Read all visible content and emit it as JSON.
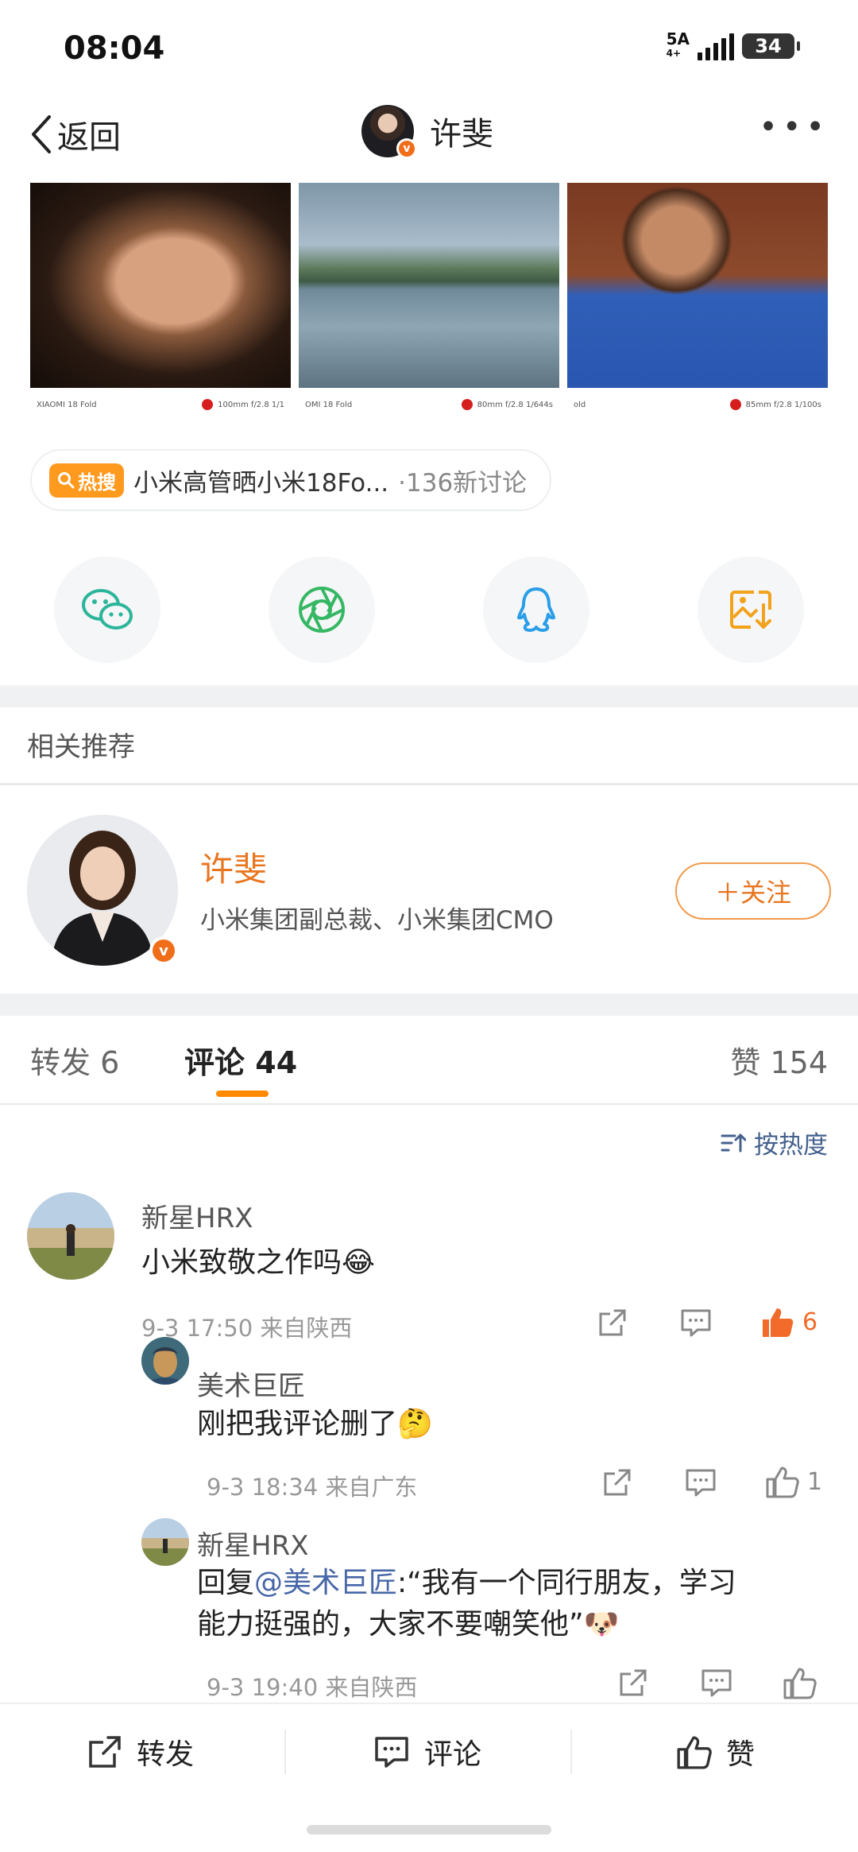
{
  "status": {
    "time": "08:04",
    "network": "5A",
    "network_sub": "4+",
    "battery": "34"
  },
  "nav": {
    "back_label": "返回",
    "title": "许斐"
  },
  "photos": [
    {
      "caption_left": "XIAOMI 18 Fold",
      "caption_right": "100mm f/2.8 1/1"
    },
    {
      "caption_left": "OMI 18 Fold",
      "caption_right": "80mm f/2.8 1/644s"
    },
    {
      "caption_left": "old",
      "caption_right": "85mm f/2.8 1/100s"
    }
  ],
  "hot_search": {
    "badge": "热搜",
    "title": "小米高管晒小米18Fo...",
    "count": "·136新讨论"
  },
  "share_icons": [
    "wechat-icon",
    "moments-icon",
    "qq-icon",
    "save-image-icon"
  ],
  "related": {
    "section_title": "相关推荐",
    "name": "许斐",
    "description": "小米集团副总裁、小米集团CMO",
    "follow_label": "＋关注"
  },
  "tabs": {
    "repost_label": "转发",
    "repost_count": "6",
    "comment_label": "评论",
    "comment_count": "44",
    "like_label": "赞",
    "like_count": "154"
  },
  "sort_label": "按热度",
  "comments": [
    {
      "user": "新星HRX",
      "text": "小米致敬之作吗😂",
      "meta": "9-3 17:50 来自陕西",
      "likes": "6"
    }
  ],
  "replies": [
    {
      "user": "美术巨匠",
      "text": "刚把我评论删了🤔",
      "meta": "9-3 18:34 来自广东",
      "likes": "1"
    },
    {
      "user": "新星HRX",
      "reply_prefix": "回复",
      "mention": "@美术巨匠",
      "text_line1": ":“我有一个同行朋友，学习",
      "text_line2": "能力挺强的，大家不要嘲笑他”🐶",
      "meta": "9-3 19:40 来自陕西"
    }
  ],
  "bottom_bar": {
    "repost_label": "转发",
    "comment_label": "评论",
    "like_label": "赞"
  },
  "colors": {
    "accent": "#ff8a00",
    "name_orange": "#e9751f",
    "like_active": "#f26b2a",
    "link_blue": "#4767a8"
  }
}
